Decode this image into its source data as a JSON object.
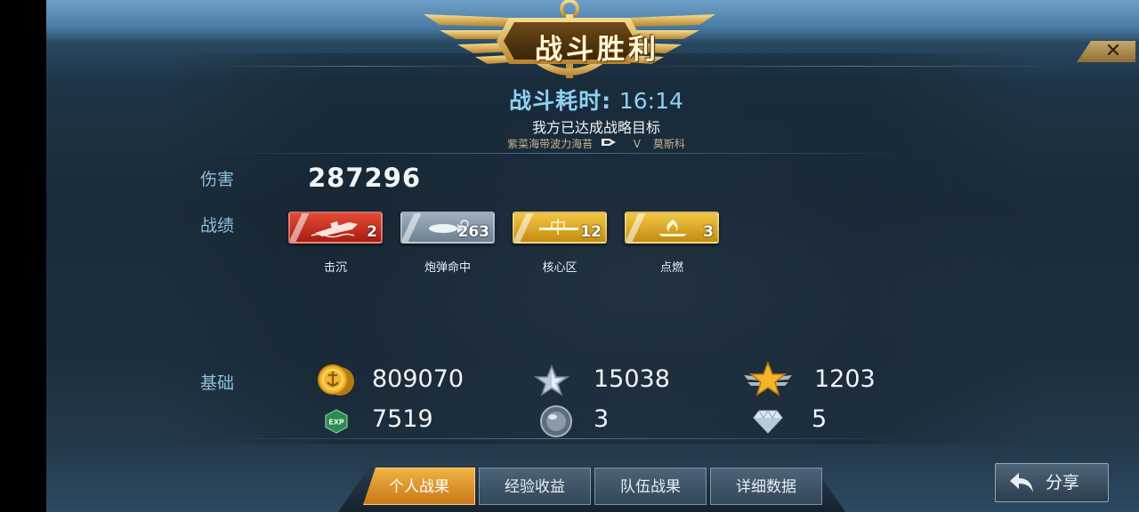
{
  "header": {
    "title": "战斗胜利",
    "close_label": "✕",
    "duration_label": "战斗耗时:",
    "duration_value": "16:14",
    "objective": "我方已达成战略目标",
    "team_left": "紫菜海带波力海苔",
    "vs": "V",
    "team_right": "莫斯科"
  },
  "stats": {
    "damage_label": "伤害",
    "damage_value": "287296",
    "record_label": "战绩",
    "medals": [
      {
        "name": "击沉",
        "count": "2",
        "color": "#c93226",
        "icon": "sinking-ship-icon"
      },
      {
        "name": "炮弹命中",
        "count": "263",
        "color": "#8396a6",
        "icon": "shell-hit-icon"
      },
      {
        "name": "核心区",
        "count": "12",
        "color": "#dfa52a",
        "icon": "citadel-icon"
      },
      {
        "name": "点燃",
        "count": "3",
        "color": "#dfa52a",
        "icon": "fire-icon"
      }
    ],
    "basic_label": "基础",
    "resources": [
      {
        "icon": "gold-coin-icon",
        "value": "809070"
      },
      {
        "icon": "silver-star-icon",
        "value": "15038"
      },
      {
        "icon": "gold-star-wings-icon",
        "value": "1203"
      },
      {
        "icon": "exp-icon",
        "value": "7519"
      },
      {
        "icon": "steel-orb-icon",
        "value": "3"
      },
      {
        "icon": "diamond-icon",
        "value": "5"
      }
    ],
    "exp_badge": "EXP"
  },
  "tabs": [
    {
      "label": "个人战果",
      "active": true
    },
    {
      "label": "经验收益",
      "active": false
    },
    {
      "label": "队伍战果",
      "active": false
    },
    {
      "label": "详细数据",
      "active": false
    }
  ],
  "share_label": "分享",
  "colors": {
    "accent_blue": "#8fd0f4",
    "label_blue": "#8fbfdc",
    "tab_active": "#e39a2e",
    "gold": "#dfa52a"
  }
}
